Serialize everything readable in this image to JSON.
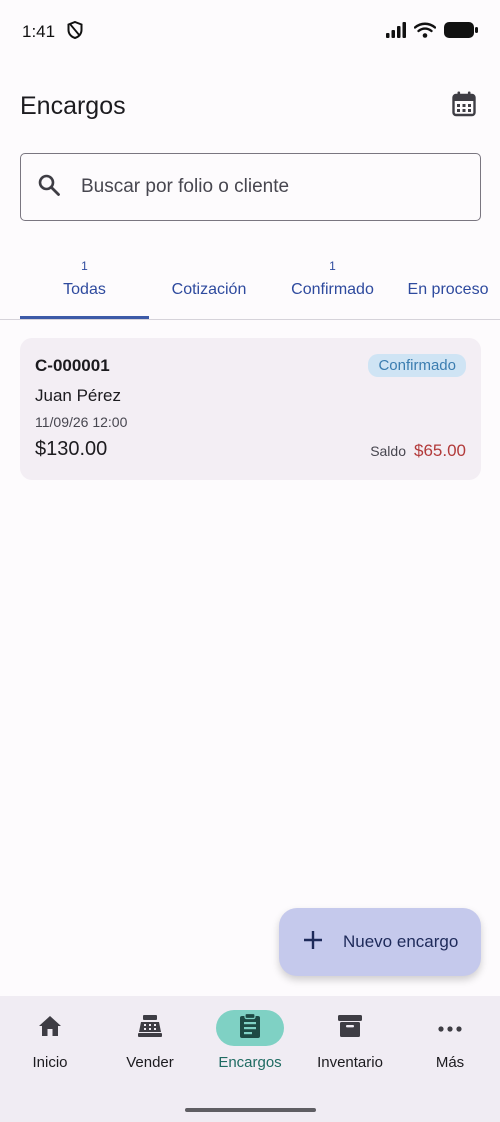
{
  "status_bar": {
    "time": "1:41"
  },
  "header": {
    "title": "Encargos"
  },
  "search": {
    "placeholder": "Buscar por folio o cliente"
  },
  "tabs": [
    {
      "count": "1",
      "label": "Todas",
      "active": true
    },
    {
      "count": "",
      "label": "Cotización"
    },
    {
      "count": "1",
      "label": "Confirmado"
    },
    {
      "count": "",
      "label": "En proceso"
    }
  ],
  "order": {
    "folio": "C-000001",
    "status": "Confirmado",
    "client": "Juan Pérez",
    "datetime": "11/09/26 12:00",
    "amount": "$130.00",
    "saldo_label": "Saldo",
    "saldo_value": "$65.00"
  },
  "fab": {
    "label": "Nuevo encargo"
  },
  "nav": [
    {
      "label": "Inicio",
      "icon": "home-icon"
    },
    {
      "label": "Vender",
      "icon": "cash-register-icon"
    },
    {
      "label": "Encargos",
      "icon": "clipboard-icon",
      "active": true
    },
    {
      "label": "Inventario",
      "icon": "archive-icon"
    },
    {
      "label": "Más",
      "icon": "more-icon"
    }
  ],
  "colors": {
    "primary": "#3d5aa8",
    "nav_active": "#7fd1c4",
    "badge_bg": "#cfe4f4",
    "saldo": "#b23a3a",
    "fab_bg": "#c5c9ec"
  }
}
